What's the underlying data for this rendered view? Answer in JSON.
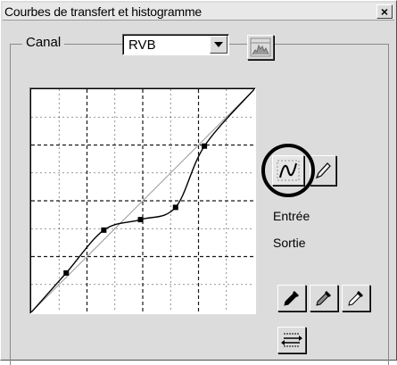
{
  "window": {
    "title": "Courbes de transfert et histogramme",
    "close_glyph": "×"
  },
  "channel": {
    "label": "Canal",
    "selected": "RVB"
  },
  "side": {
    "input_label": "Entrée",
    "output_label": "Sortie"
  },
  "icons": {
    "histogram": "histogram-icon",
    "smooth_curve": "smooth-curve-icon",
    "pencil": "pencil-icon",
    "eyedropper_black": "black-point-eyedropper-icon",
    "eyedropper_gray": "gray-point-eyedropper-icon",
    "eyedropper_white": "white-point-eyedropper-icon",
    "swap": "swap-arrows-icon"
  },
  "curve": {
    "range": [
      0,
      255
    ],
    "grid_divisions": 8,
    "control_points": [
      [
        0,
        0
      ],
      [
        40,
        45
      ],
      [
        83,
        94
      ],
      [
        125,
        106
      ],
      [
        165,
        120
      ],
      [
        198,
        190
      ],
      [
        255,
        255
      ]
    ],
    "colors": {
      "curve": "#000000",
      "diagonal": "#9a9a9a",
      "grid": "#000000"
    }
  }
}
